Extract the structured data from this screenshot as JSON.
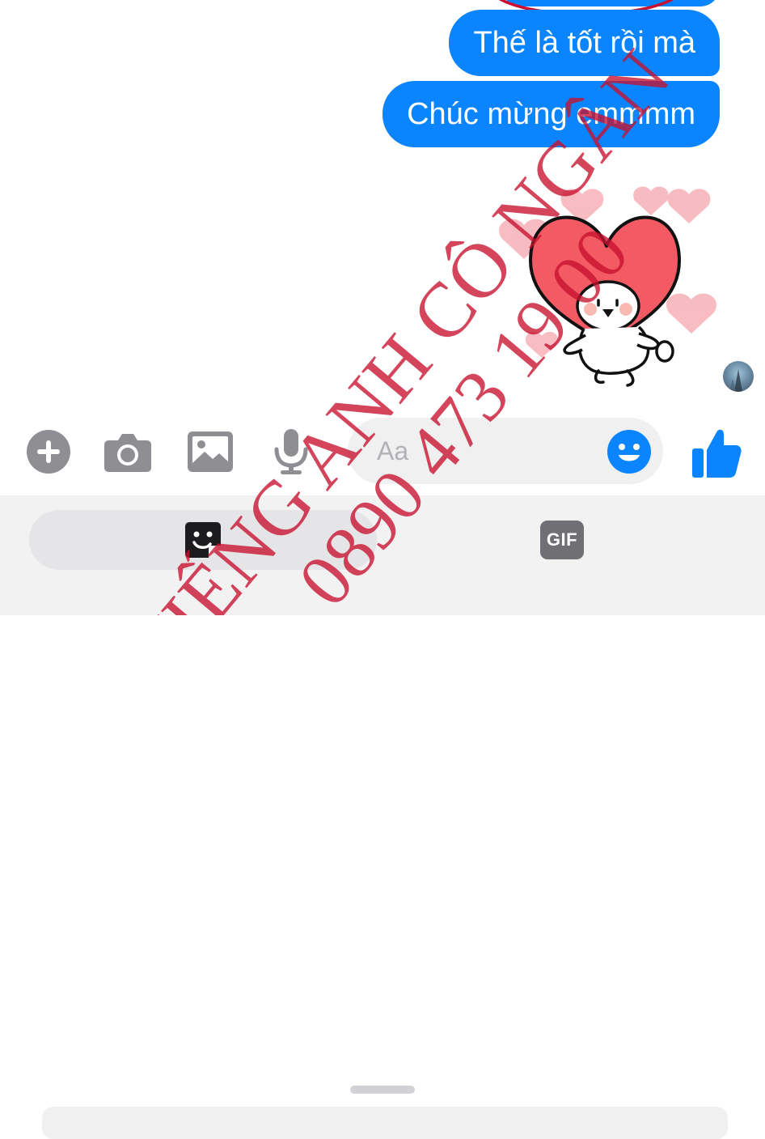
{
  "messages": [
    {
      "text": "Thế là tốt rồi mà"
    },
    {
      "text": "Chúc mừng emmmm"
    }
  ],
  "sticker": {
    "icon": "heart-head-bunny-sticker"
  },
  "composer": {
    "placeholder": "Aa",
    "tools": [
      "plus-icon",
      "camera-icon",
      "image-icon",
      "microphone-icon"
    ],
    "emoji_icon": "smiley-icon",
    "like_icon": "thumbs-up-icon"
  },
  "tabs": {
    "gif_label": "GIF",
    "stickers_icon": "sticker-icon"
  },
  "watermark": {
    "line1": "TIẾNG ANH CÔ NGÂN",
    "line2": "0890 473 19 00"
  },
  "colors": {
    "accent": "#0a84ff",
    "icon_gray": "#8e8e93",
    "watermark": "#c8102e"
  }
}
